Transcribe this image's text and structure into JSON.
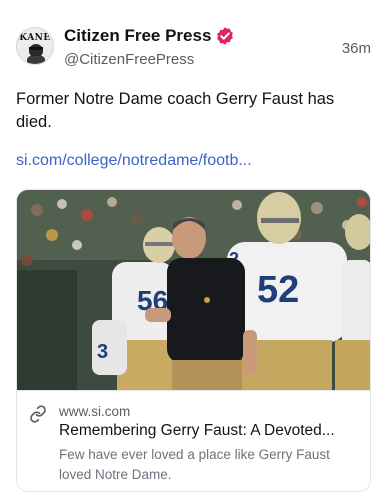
{
  "author": {
    "name": "Citizen Free Press",
    "handle": "@CitizenFreePress",
    "avatar_text": "KANE",
    "verified": true,
    "verified_color": "#e0245e"
  },
  "post": {
    "timestamp": "36m",
    "text": "Former Notre Dame coach Gerry Faust has died.",
    "link_text": "si.com/college/notredame/footb..."
  },
  "link_card": {
    "icon": "link-icon",
    "domain": "www.si.com",
    "title": "Remembering Gerry Faust: A Devoted...",
    "description": "Few have ever loved a place like Gerry Faust loved Notre Dame.",
    "image_jerseys": [
      "2",
      "56",
      "52",
      "3"
    ]
  },
  "colors": {
    "link": "#3d63c9",
    "secondary_text": "#555d66",
    "jersey_navy": "#1f3f7a",
    "pants_gold": "#b3935a"
  }
}
